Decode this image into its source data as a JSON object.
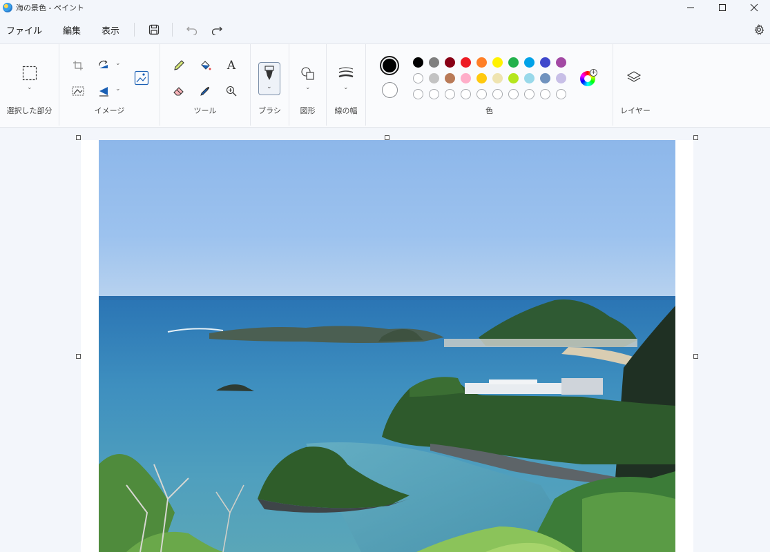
{
  "window": {
    "title": "海の景色 - ペイント",
    "controls": {
      "minimize": "—",
      "maximize": "☐",
      "close": "✕"
    }
  },
  "menu": {
    "file": "ファイル",
    "edit": "編集",
    "view": "表示"
  },
  "ribbon": {
    "selection_label": "選択した部分",
    "image_label": "イメージ",
    "tools_label": "ツール",
    "brush_label": "ブラシ",
    "shapes_label": "図形",
    "stroke_label": "線の幅",
    "colors_label": "色",
    "layers_label": "レイヤー",
    "text_tool_glyph": "A"
  },
  "colors": {
    "primary": "#000000",
    "secondary": "#ffffff",
    "palette_row1": [
      "#000000",
      "#7f7f7f",
      "#880015",
      "#ed1c24",
      "#ff7f27",
      "#fff200",
      "#22b14c",
      "#00a2e8",
      "#3f48cc",
      "#a349a4"
    ],
    "palette_row2": [
      "#ffffff",
      "#c3c3c3",
      "#b97a57",
      "#ffaec9",
      "#ffc90e",
      "#efe4b0",
      "#b5e61d",
      "#99d9ea",
      "#7092be",
      "#c8bfe7"
    ],
    "custom_row_count_label": ""
  },
  "icons": {
    "app": "paint-app-icon",
    "save": "save-icon",
    "undo": "undo-icon",
    "redo": "redo-icon",
    "settings": "gear-icon"
  }
}
